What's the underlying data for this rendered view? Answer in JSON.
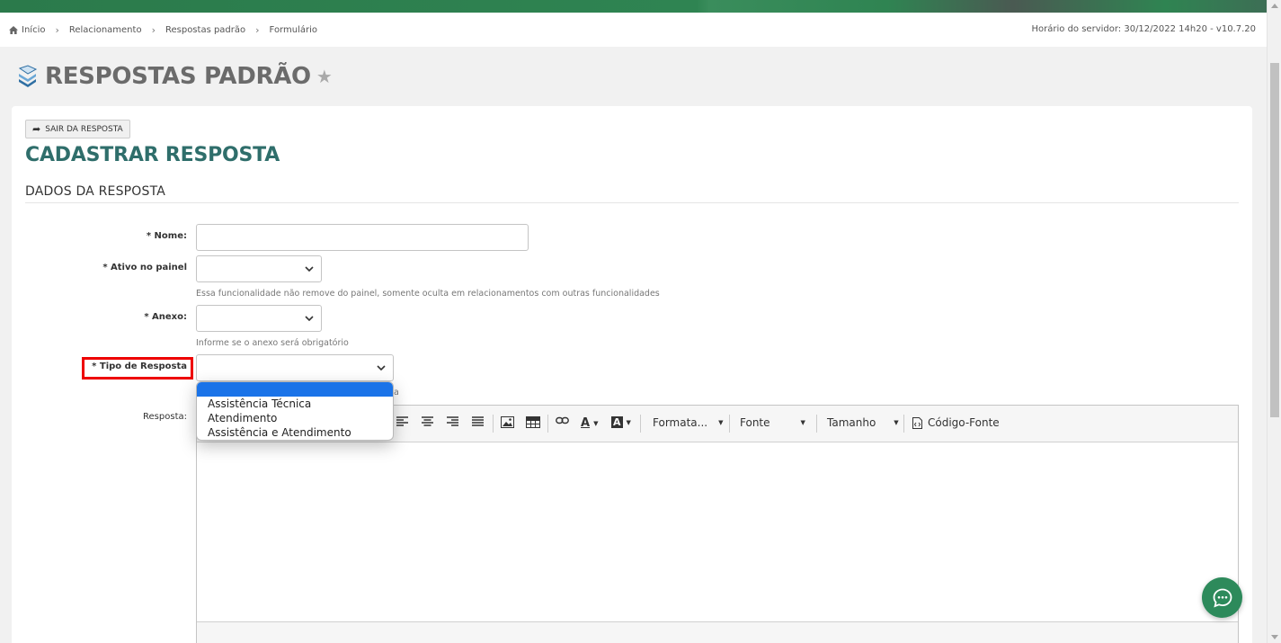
{
  "breadcrumb": {
    "items": [
      "Início",
      "Relacionamento",
      "Respostas padrão",
      "Formulário"
    ],
    "server_time": "Horário do servidor: 30/12/2022 14h20 - v10.7.20"
  },
  "page": {
    "title": "RESPOSTAS PADRÃO"
  },
  "form": {
    "exit_label": "SAIR DA RESPOSTA",
    "title": "CADASTRAR RESPOSTA",
    "section": "DADOS DA RESPOSTA",
    "fields": {
      "nome": {
        "label": "* Nome:",
        "value": ""
      },
      "ativo": {
        "label": "* Ativo no painel",
        "value": "",
        "help": "Essa funcionalidade não remove do painel, somente oculta em relacionamentos com outras funcionalidades"
      },
      "anexo": {
        "label": "* Anexo:",
        "value": "",
        "help": "Informe se o anexo será obrigatório"
      },
      "tipo": {
        "label": "* Tipo de Resposta",
        "value": "",
        "help_tail": "a"
      },
      "resposta": {
        "label": "Resposta:"
      }
    }
  },
  "dropdown": {
    "options": [
      "",
      "Assistência Técnica",
      "Atendimento",
      "Assistência e Atendimento"
    ]
  },
  "editor": {
    "format_label": "Formata...",
    "font_label": "Fonte",
    "size_label": "Tamanho",
    "source_label": "Código-Fonte"
  },
  "colors": {
    "accent": "#2f6e6b",
    "brand_green": "#2d8a5b",
    "highlight": "#ee0000",
    "dropdown_selected": "#1a73e8"
  }
}
